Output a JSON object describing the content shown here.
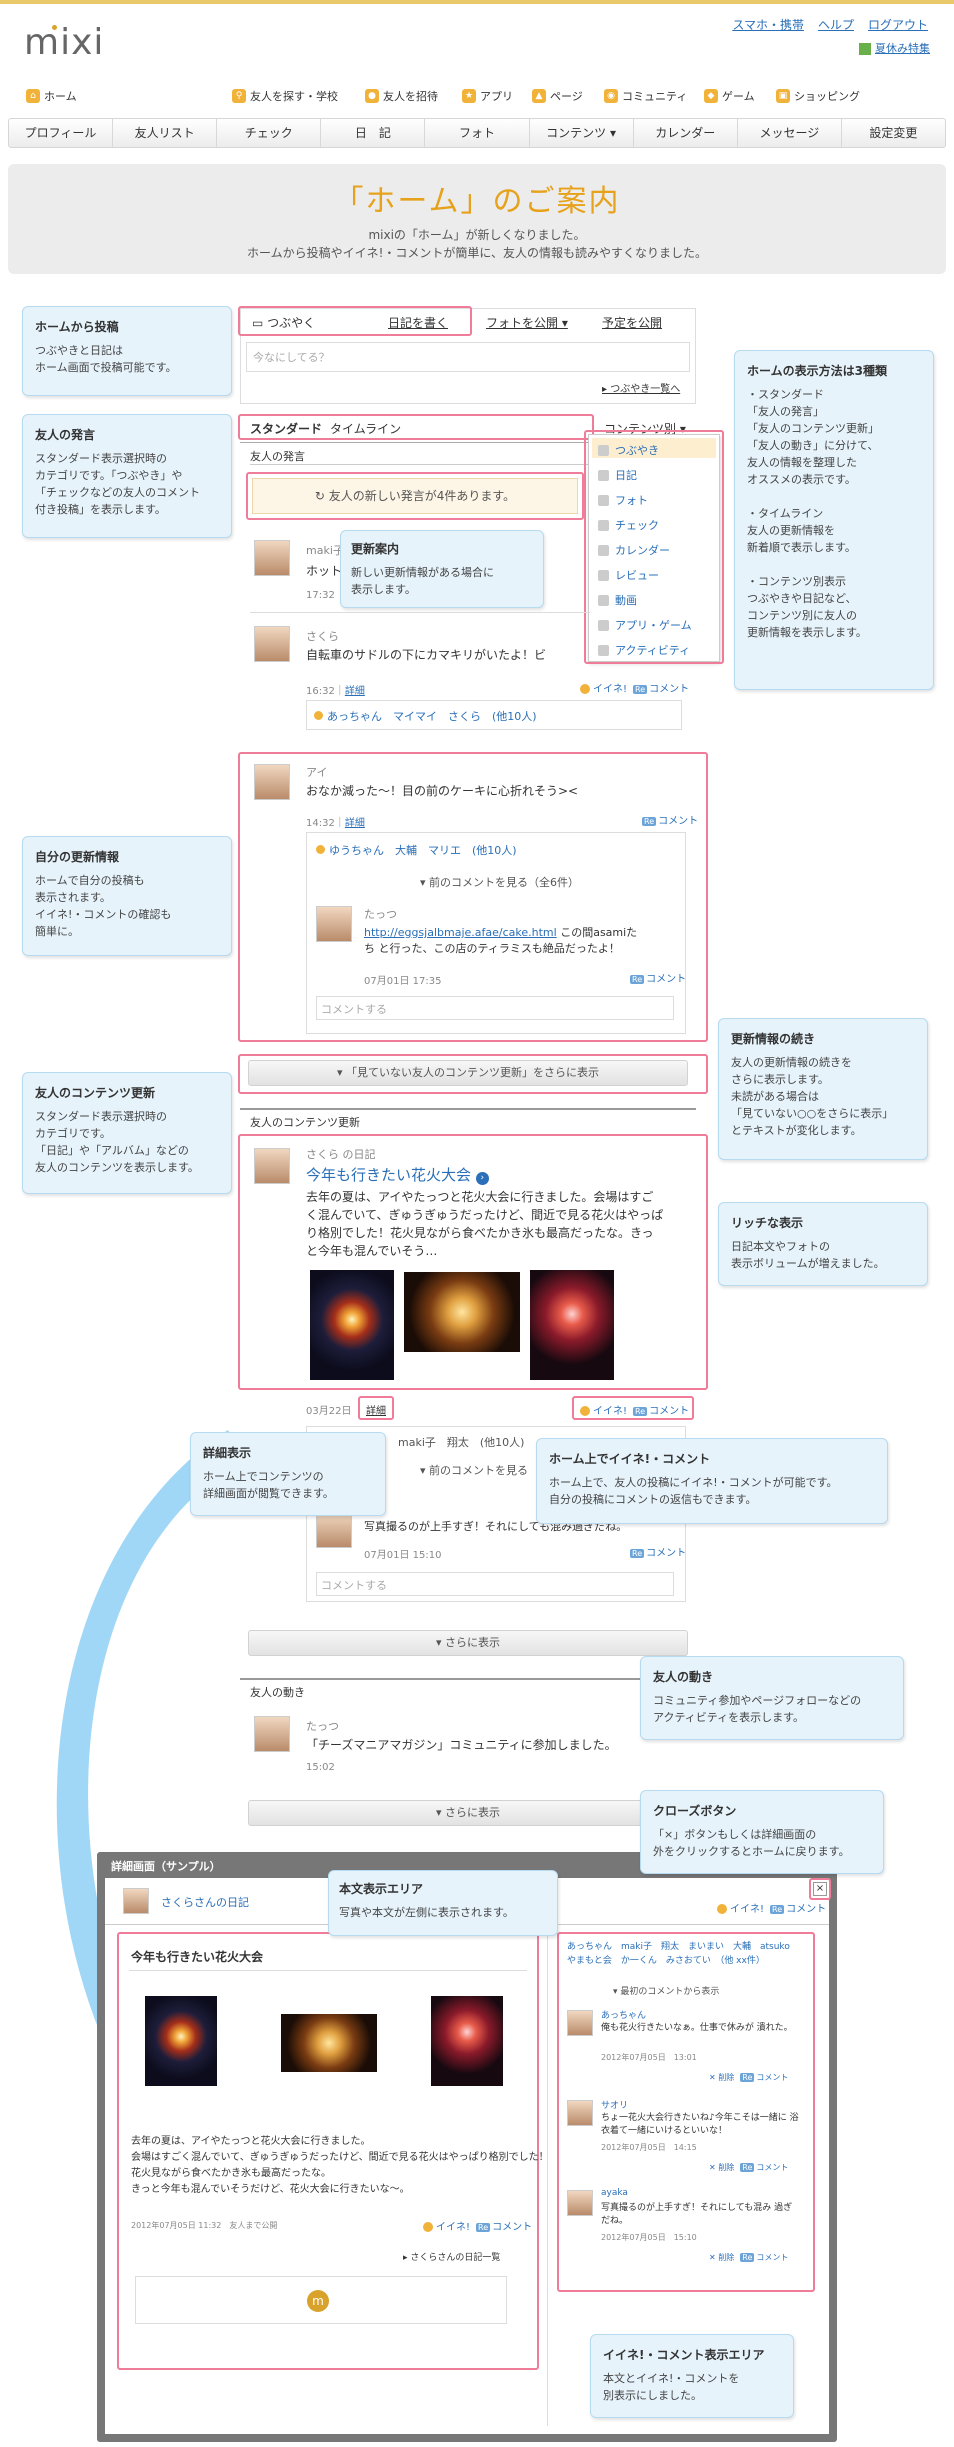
{
  "header": {
    "logo": "mixi",
    "links": [
      "スマホ・携帯",
      "ヘルプ",
      "ログアウト"
    ],
    "summer": "夏休み特集"
  },
  "nav1": [
    "ホーム",
    "友人を探す・学校",
    "友人を招待",
    "アプリ",
    "ページ",
    "コミュニティ",
    "ゲーム",
    "ショッピング"
  ],
  "nav2": [
    "プロフィール",
    "友人リスト",
    "チェック",
    "日　記",
    "フォト",
    "コンテンツ ▾",
    "カレンダー",
    "メッセージ",
    "設定変更"
  ],
  "banner": {
    "title": "「ホーム」のご案内",
    "line1": "mixiの「ホーム」が新しくなりました。",
    "line2": "ホームから投稿やイイネ!・コメントが簡単に、友人の情報も読みやすくなりました。"
  },
  "post": {
    "tab1": "つぶやく",
    "tab2": "日記を書く",
    "tab3": "フォトを公開 ▾",
    "tab4": "予定を公開",
    "placeholder": "今なにしてる？",
    "more": "▸ つぶやき一覧へ"
  },
  "view": {
    "standard": "スタンダード",
    "timeline": "タイムライン",
    "content": "コンテンツ別 ▾",
    "section1": "友人の発言",
    "newbox": "友人の新しい発言が4件あります。"
  },
  "menu": [
    "つぶやき",
    "日記",
    "フォト",
    "チェック",
    "カレンダー",
    "レビュー",
    "動画",
    "アプリ・ゲーム",
    "アクティビティ"
  ],
  "feed": {
    "p1_name": "maki子",
    "p1_text": "ホット",
    "p1_time": "17:32",
    "p2_name": "さくら",
    "p2_text": "自転車のサドルの下にカマキリがいたよ！ビ",
    "p2_time": "16:32",
    "p2_detail": "詳細",
    "p2_likes": "あっちゃん　マイマイ　さくら　(他10人)",
    "p3_name": "アイ",
    "p3_text": "おなか減った〜！目の前のケーキに心折れそう><",
    "p3_time": "14:32",
    "p3_detail": "詳細",
    "p3_likes": "ゆうちゃん　大輔　マリエ　(他10人)",
    "p3_prev": "▾ 前のコメントを見る（全6件）",
    "p3_c_name": "たっつ",
    "p3_c_url": "http://eggsjalbmaje.afae/cake.html",
    "p3_c_text1": "この間asamiた",
    "p3_c_text2": "ち と行った、この店のティラミスも絶品だったよ！",
    "p3_c_time": "07月01日 17:35",
    "p3_comment": "コメントする",
    "more_btn": "▾ 「見ていない友人のコンテンツ更新」をさらに表示",
    "section2": "友人のコンテンツ更新",
    "d_owner": "さくら の日記",
    "d_title": "今年も行きたい花火大会",
    "d_body1": "去年の夏は、アイやたっつと花火大会に行きました。会場はすご",
    "d_body2": "く混んでいて、ぎゅうぎゅうだったけど、間近で見る花火はやっぱ",
    "d_body3": "り格別でした！花火見ながら食べたかき氷も最高だったな。きっ",
    "d_body4": "と今年も混んでいそう…",
    "d_time": "03月22日",
    "d_detail": "詳細",
    "d_likes": "maki子　翔太　(他10人)",
    "d_prev": "▾ 前のコメントを見る",
    "d_c_text": "写真撮るのが上手すぎ！それにしても混み過ぎだね。",
    "d_c_time": "07月01日 15:10",
    "d_comment": "コメントする",
    "more2": "▾ さらに表示",
    "section3": "友人の動き",
    "a_name": "たっつ",
    "a_text": "「チーズマニアマガジン」コミュニティに参加しました。",
    "a_time": "15:02",
    "more3": "▾ さらに表示"
  },
  "likes": {
    "like": "イイネ!",
    "comment": "コメント",
    "re": "Re"
  },
  "notes": {
    "n1_t": "ホームから投稿",
    "n1_b": "つぶやきと日記は\nホーム画面で投稿可能です。",
    "n2_t": "友人の発言",
    "n2_b": "スタンダード表示選択時の\nカテゴリです。「つぶやき」や\n「チェックなどの友人のコメント\n付き投稿」を表示します。",
    "n3_t": "更新案内",
    "n3_b": "新しい更新情報がある場合に\n表示します。",
    "n4_t": "ホームの表示方法は3種類",
    "n4_b": "・スタンダード\n「友人の発言」\n「友人のコンテンツ更新」\n「友人の動き」に分けて、\n友人の情報を整理した\nオススメの表示です。\n\n・タイムライン\n友人の更新情報を\n新着順で表示します。\n\n・コンテンツ別表示\nつぶやきや日記など、\nコンテンツ別に友人の\n更新情報を表示します。",
    "n5_t": "自分の更新情報",
    "n5_b": "ホームで自分の投稿も\n表示されます。\nイイネ!・コメントの確認も\n簡単に。",
    "n6_t": "更新情報の続き",
    "n6_b": "友人の更新情報の続きを\nさらに表示します。\n未読がある場合は\n「見ていない○○をさらに表示」\nとテキストが変化します。",
    "n7_t": "友人のコンテンツ更新",
    "n7_b": "スタンダード表示選択時の\nカテゴリです。\n「日記」や「アルバム」などの\n友人のコンテンツを表示します。",
    "n8_t": "リッチな表示",
    "n8_b": "日記本文やフォトの\n表示ボリュームが増えました。",
    "n9_t": "詳細表示",
    "n9_b": "ホーム上でコンテンツの\n詳細画面が閲覧できます。",
    "n10_t": "ホーム上でイイネ!・コメント",
    "n10_b": "ホーム上で、友人の投稿にイイネ!・コメントが可能です。\n自分の投稿にコメントの返信もできます。",
    "n11_t": "友人の動き",
    "n11_b": "コミュニティ参加やページフォローなどの\nアクティビティを表示します。",
    "n12_t": "クローズボタン",
    "n12_b": "「×」ボタンもしくは詳細画面の\n外をクリックするとホームに戻ります。",
    "n13_t": "本文表示エリア",
    "n13_b": "写真や本文が左側に表示されます。",
    "n14_t": "イイネ!・コメント表示エリア",
    "n14_b": "本文とイイネ!・コメントを\n別表示にしました。"
  },
  "modal": {
    "label": "詳細画面（サンプル）",
    "owner": "さくらさんの日記",
    "close": "×",
    "title": "今年も行きたい花火大会",
    "body1": "去年の夏は、アイやたっつと花火大会に行きました。",
    "body2": "会場はすごく混んでいて、ぎゅうぎゅうだったけど、間近で見る花火はやっぱり格別でした！",
    "body3": "花火見ながら食べたかき氷も最高だったな。",
    "body4": "きっと今年も混んでいそうだけど、花火大会に行きたいな〜。",
    "meta": "2012年07月05日 11:32　友人まで公開",
    "link": "▸ さくらさんの日記一覧",
    "likes": "あっちゃん　maki子　翔太　まいまい　大輔　atsuko　やまもと会　か一くん　みさおてい　（他 xx件）",
    "prev": "▾ 最初のコメントから表示",
    "c1_name": "あっちゃん",
    "c1_text": "俺も花火行きたいなぁ。仕事で休みが 潰れた。",
    "c1_time": "2012年07月05日　13:01",
    "c2_name": "サオリ",
    "c2_text": "ちょ一花火大会行きたいね♪今年こそは一緒に 浴衣着て一緒にいけるといいな！",
    "c2_time": "2012年07月05日　14:15",
    "c3_name": "ayaka",
    "c3_text": "写真撮るのが上手すぎ！それにしても混み 過ぎだね。",
    "c3_time": "2012年07月05日　15:10",
    "del": "✕ 削除",
    "stamp": "m"
  }
}
